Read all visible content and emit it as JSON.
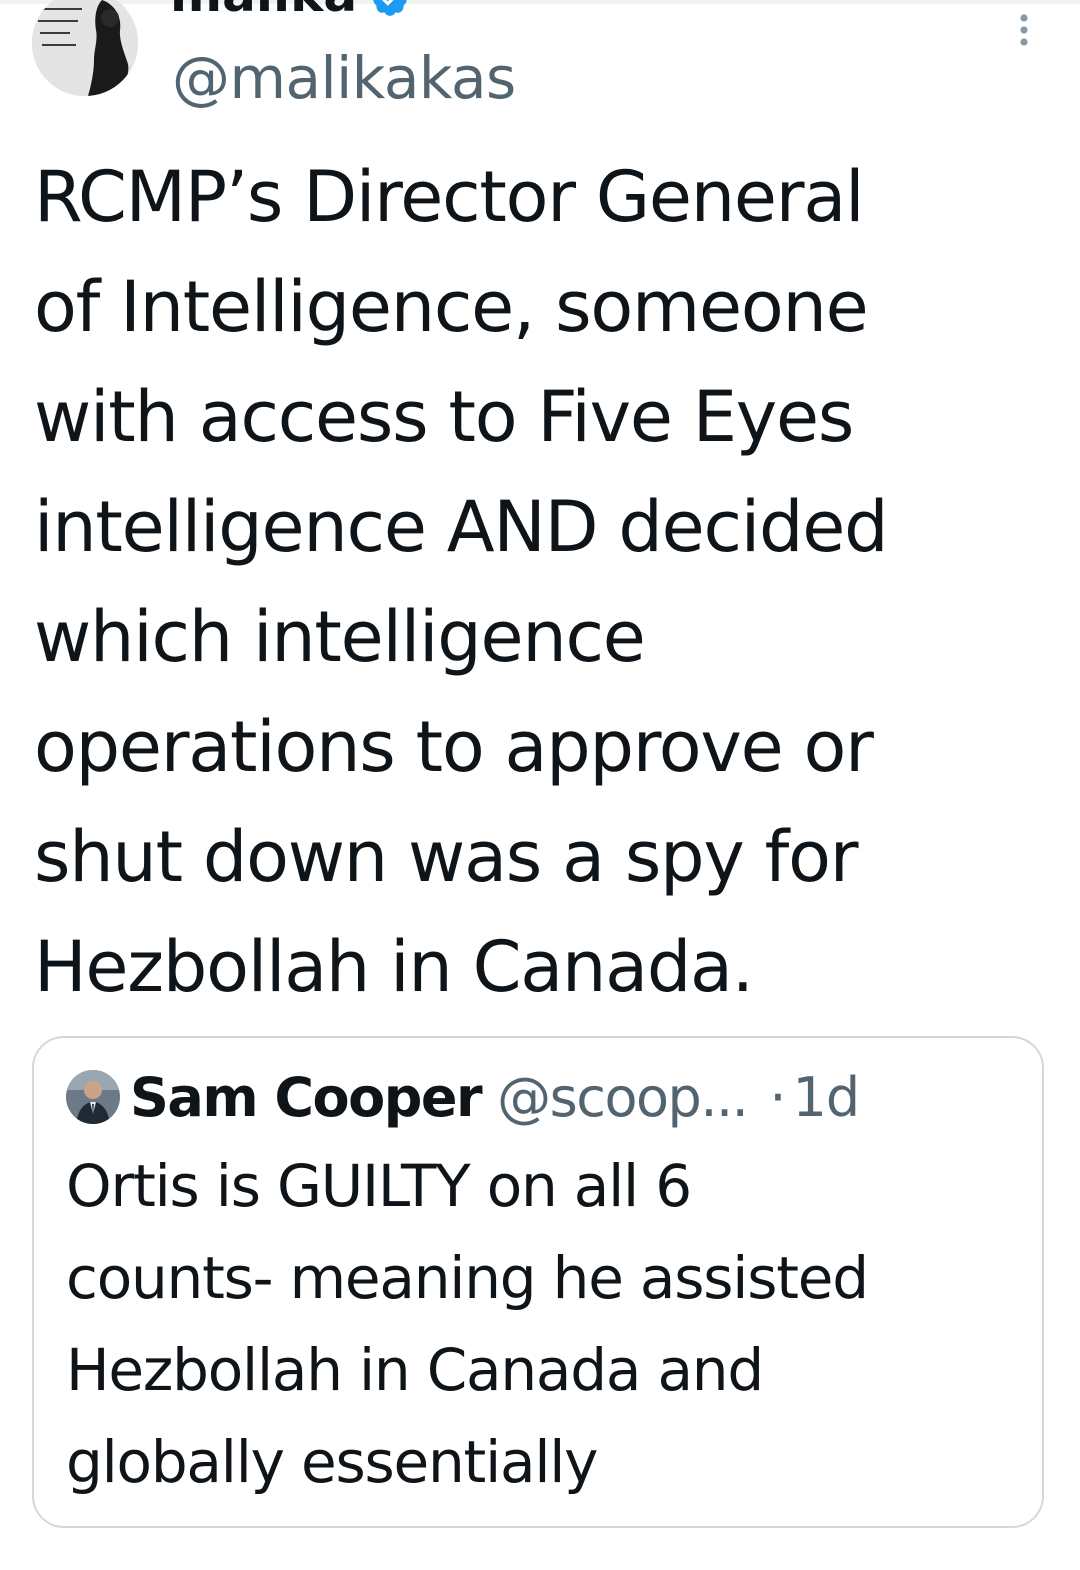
{
  "tweet": {
    "author": {
      "display_name": "malika",
      "handle": "@malikakas",
      "avatar_icon": "avatar-photo-quote-icon",
      "verified": true,
      "verified_color": "#1d9bf0"
    },
    "text_lines": [
      "RCMP’s Director General",
      "of Intelligence, someone",
      "with access to Five Eyes",
      "intelligence AND decided",
      "which intelligence",
      "operations to approve or",
      "shut down was a spy for",
      "Hezbollah in Canada."
    ],
    "more_icon": "more-vertical-icon"
  },
  "quote": {
    "author": {
      "display_name": "Sam Cooper",
      "handle": "@scoop...",
      "separator": "·",
      "time": "1d",
      "avatar_icon": "avatar-photo-icon"
    },
    "text_lines": [
      "Ortis is GUILTY on all 6",
      "counts- meaning he assisted",
      "Hezbollah in Canada and",
      "globally essentially"
    ]
  },
  "colors": {
    "text_primary": "#0f1419",
    "text_secondary": "#536471",
    "border": "#cfd9de",
    "accent": "#1d9bf0"
  }
}
